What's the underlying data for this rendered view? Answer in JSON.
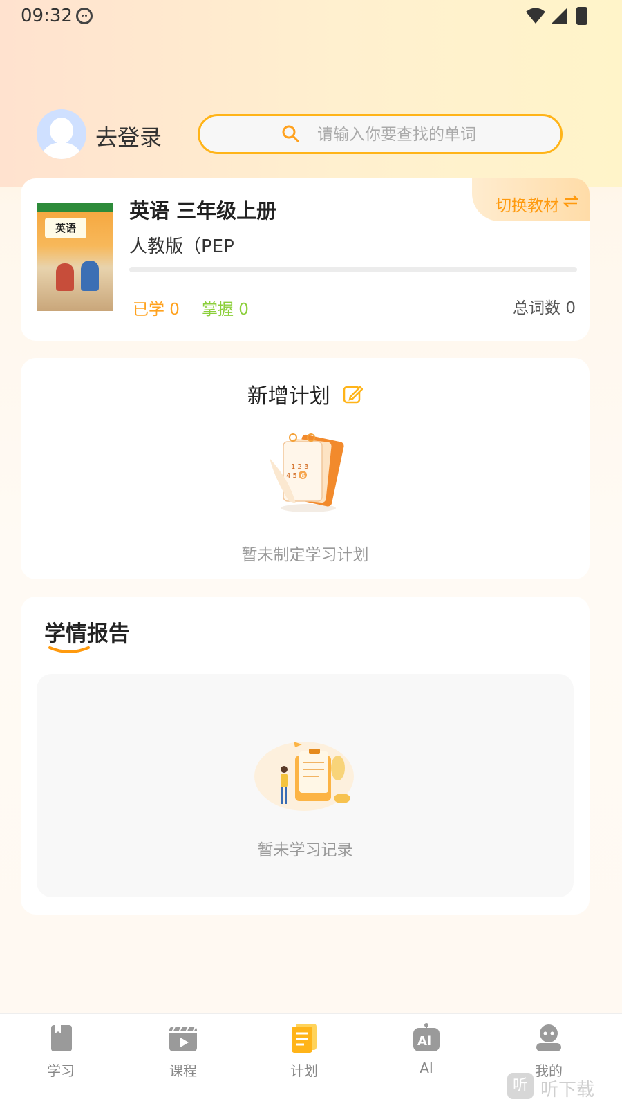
{
  "status_bar": {
    "time": "09:32"
  },
  "header": {
    "login_label": "去登录",
    "search_placeholder": "请输入你要查找的单词"
  },
  "book": {
    "title": "英语 三年级上册",
    "edition": "人教版（PEP",
    "switch_label": "切换教材",
    "learned": "已学  0",
    "mastered": "掌握  0",
    "total": "总词数 0",
    "progress_fraction": 0
  },
  "plan": {
    "title": "新增计划",
    "empty_text": "暂未制定学习计划"
  },
  "report": {
    "title": "学情报告",
    "empty_text": "暂未学习记录"
  },
  "tabs": [
    {
      "label": "学习",
      "icon": "book-icon"
    },
    {
      "label": "课程",
      "icon": "video-icon"
    },
    {
      "label": "计划",
      "icon": "plan-icon"
    },
    {
      "label": "AI",
      "icon": "ai-icon"
    },
    {
      "label": "我的",
      "icon": "profile-icon"
    }
  ],
  "watermark": {
    "text": "听下载"
  },
  "colors": {
    "accent": "#ffb419",
    "orange_text": "#ff9a0e",
    "green_text": "#8ccf3b"
  }
}
